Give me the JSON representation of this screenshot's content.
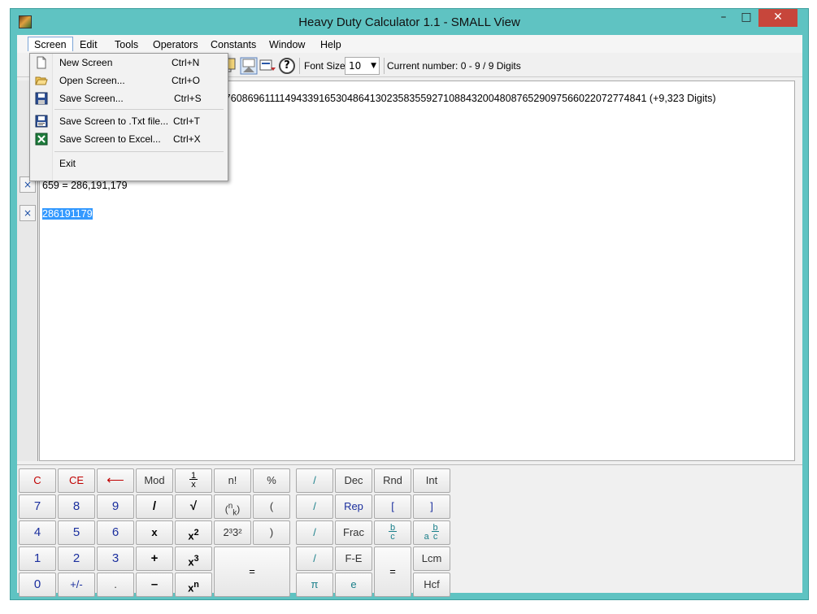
{
  "window": {
    "title": "Heavy Duty Calculator 1.1 - SMALL View",
    "min_glyph": "–",
    "max_glyph": "□",
    "close_glyph": "✕"
  },
  "menubar": {
    "items": [
      "Screen",
      "Edit",
      "Tools",
      "Operators",
      "Constants",
      "Window",
      "Help"
    ],
    "active": "Screen"
  },
  "toolbar": {
    "help_glyph": "?",
    "font_size_label": "Font Size",
    "font_size_value": "10",
    "current_number": "Current number: 0 - 9 / 9 Digits"
  },
  "screen_menu": {
    "items": [
      {
        "label": "New Screen",
        "shortcut": "Ctrl+N",
        "icon": "new-document-icon"
      },
      {
        "label": "Open Screen...",
        "shortcut": "Ctrl+O",
        "icon": "open-folder-icon"
      },
      {
        "label": "Save Screen...",
        "shortcut": "Ctrl+S",
        "icon": "floppy-disk-icon"
      },
      {
        "label": "Save Screen to .Txt file...",
        "shortcut": "Ctrl+T",
        "icon": "save-txt-icon"
      },
      {
        "label": "Save Screen to Excel...",
        "shortcut": "Ctrl+X",
        "icon": "excel-icon"
      },
      {
        "label": "Exit",
        "shortcut": "",
        "icon": ""
      }
    ]
  },
  "screen": {
    "line1": "3084760869611114943391653048641302358355927108843200480876529097566022072774841",
    "line1_suffix": "(+9,323 Digits)",
    "line2": "659  = 286,191,179",
    "line3": "286191179",
    "row_close_glyph": "×"
  },
  "keypad": {
    "block1": [
      [
        "C",
        "CE",
        "⟵",
        "Mod",
        "1/x",
        "n!",
        "%"
      ],
      [
        "7",
        "8",
        "9",
        "/",
        "√",
        "(n k)",
        "("
      ],
      [
        "4",
        "5",
        "6",
        "x",
        "x2",
        "2³3²",
        ")"
      ],
      [
        "1",
        "2",
        "3",
        "+",
        "x3",
        "="
      ],
      [
        "0",
        "+/-",
        ".",
        "–",
        "xn"
      ]
    ],
    "block2": [
      [
        "/",
        "Dec",
        "Rnd",
        "Int"
      ],
      [
        "/",
        "Rep",
        "[",
        "]"
      ],
      [
        "/",
        "Frac",
        "b/c",
        "a b/c"
      ],
      [
        "/",
        "F-E",
        "=",
        "Lcm"
      ],
      [
        "π",
        "e",
        "Hcf"
      ]
    ],
    "labels": {
      "C": "C",
      "CE": "CE",
      "back": "⟵",
      "mod": "Mod",
      "recip_num": "1",
      "recip_den": "x",
      "fact": "n!",
      "pct": "%",
      "k7": "7",
      "k8": "8",
      "k9": "9",
      "div": "/",
      "sqrt": "√",
      "comb_n": "n",
      "comb_k": "k",
      "lparen": "(",
      "k4": "4",
      "k5": "5",
      "k6": "6",
      "mul": "x",
      "sq_base": "x",
      "sq_exp": "2",
      "pow_misc": "2³3²",
      "rparen": ")",
      "k1": "1",
      "k2": "2",
      "k3": "3",
      "plus": "+",
      "cube_base": "x",
      "cube_exp": "3",
      "eq": "=",
      "k0": "0",
      "neg": "+/-",
      "dot": ".",
      "minus": "–",
      "xn_base": "x",
      "xn_exp": "n",
      "slash": "/",
      "dec": "Dec",
      "rnd": "Rnd",
      "int": "Int",
      "rep": "Rep",
      "lbr": "[",
      "rbr": "]",
      "frac": "Frac",
      "b": "b",
      "c": "c",
      "a": "a",
      "fe": "F-E",
      "lcm": "Lcm",
      "pi": "π",
      "e": "e",
      "hcf": "Hcf"
    }
  },
  "colors": {
    "frame": "#5fc3c2",
    "close": "#c7463b",
    "selection": "#3399ff",
    "red_key": "#c00000",
    "blue_key": "#1b2f9e",
    "teal_key": "#1a7f8a"
  }
}
